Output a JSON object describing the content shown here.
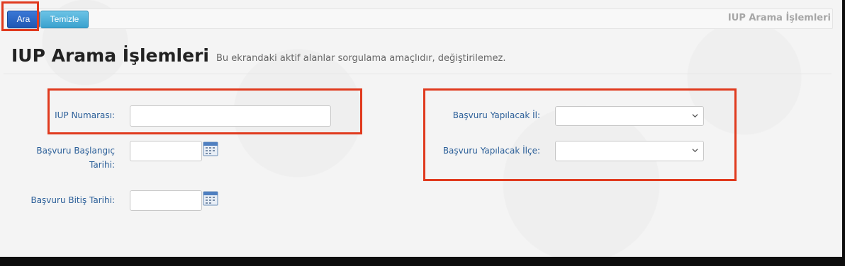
{
  "toolbar": {
    "search_label": "Ara",
    "clear_label": "Temizle",
    "title": "IUP Arama İşlemleri"
  },
  "page": {
    "title": "IUP Arama İşlemleri",
    "subtitle": "Bu ekrandaki aktif alanlar sorgulama amaçlıdır, değiştirilemez."
  },
  "form": {
    "iup_number_label": "IUP Numarası:",
    "iup_number_value": "",
    "start_date_label_line1": "Başvuru Başlangıç",
    "start_date_label_line2": "Tarihi:",
    "start_date_value": "",
    "end_date_label": "Başvuru Bitiş Tarihi:",
    "end_date_value": "",
    "province_label": "Başvuru Yapılacak İl:",
    "province_selected": "",
    "district_label": "Başvuru Yapılacak İlçe:",
    "district_selected": ""
  },
  "icons": {
    "calendar": "calendar-icon",
    "dropdown": "chevron-down-icon"
  },
  "colors": {
    "primary_button": "#1f57b3",
    "secondary_button": "#3aa2cf",
    "label_text": "#2a5e98",
    "highlight": "#e03a1e"
  }
}
